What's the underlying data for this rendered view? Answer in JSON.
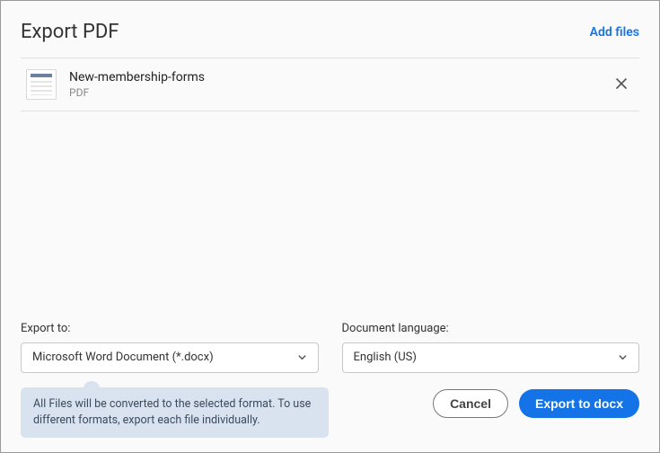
{
  "header": {
    "title": "Export PDF",
    "add_files": "Add files"
  },
  "files": [
    {
      "name": "New-membership-forms",
      "type": "PDF"
    }
  ],
  "export_to": {
    "label": "Export to:",
    "value": "Microsoft Word Document (*.docx)"
  },
  "language": {
    "label": "Document language:",
    "value": "English (US)"
  },
  "tooltip": "All Files will be converted to the selected format. To use different formats, export each file individually.",
  "buttons": {
    "cancel": "Cancel",
    "export": "Export to docx"
  }
}
